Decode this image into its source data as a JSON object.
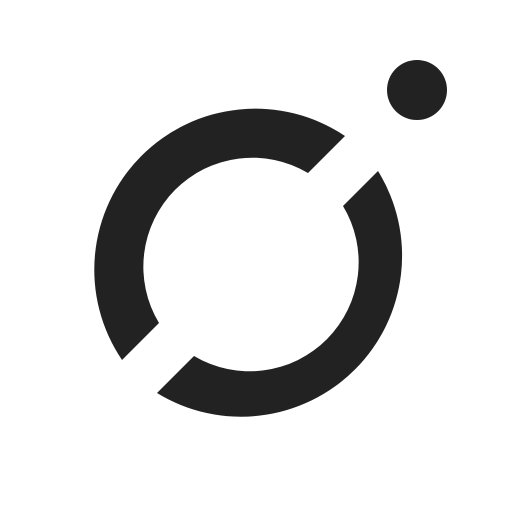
{
  "logo": {
    "icon": "ring-with-dot-logo",
    "colors": {
      "background": "#ffffff",
      "mark": "#222222"
    }
  }
}
